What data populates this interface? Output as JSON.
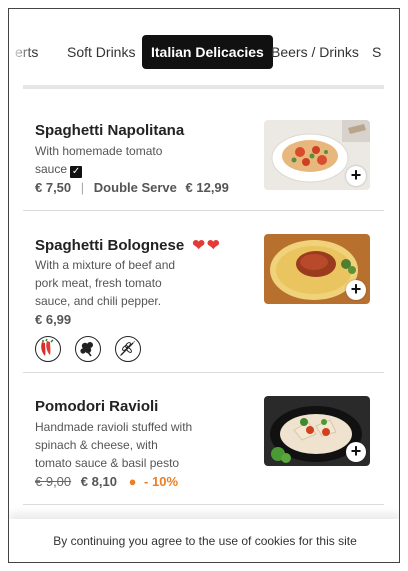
{
  "tabs": [
    {
      "label": "erts"
    },
    {
      "label": "Soft Drinks"
    },
    {
      "label": "Italian Delicacies"
    },
    {
      "label": "Beers / Drinks"
    },
    {
      "label": "S"
    }
  ],
  "active_tab_index": 2,
  "items": [
    {
      "title": "Spaghetti Napolitana",
      "description_line1": "With homemade tomato",
      "description_line2": "sauce",
      "price": "€ 7,50",
      "price_separator": "|",
      "option_label": "Double Serve",
      "option_price": "€ 12,99",
      "add_label": "+"
    },
    {
      "title": "Spaghetti Bolognese",
      "hearts": 2,
      "description": "With a mixture of beef and pork meat, fresh tomato sauce, and chili pepper.",
      "price": "€ 6,99",
      "add_label": "+",
      "allergens": [
        "chili-pepper-icon",
        "celery-icon",
        "gluten-icon"
      ]
    },
    {
      "title": "Pomodori Ravioli",
      "description": "Handmade ravioli stuffed with spinach & cheese, with tomato sauce & basil pesto",
      "old_price": "€ 9,00",
      "price": "€ 8,10",
      "discount": "- 10%",
      "add_label": "+"
    }
  ],
  "cookie_notice": "By continuing you agree to the use of cookies for this site",
  "colors": {
    "accent": "#ef7d22",
    "heart": "#e53935",
    "active_tab_bg": "#111111"
  }
}
